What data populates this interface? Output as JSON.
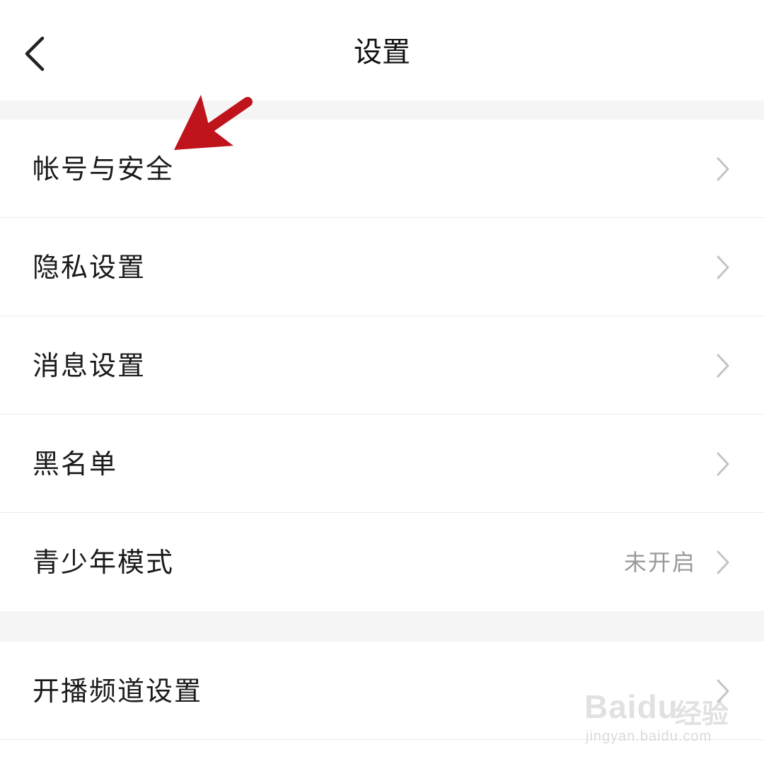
{
  "header": {
    "title": "设置",
    "back_icon": "chevron-left-icon"
  },
  "group1": {
    "items": [
      {
        "label": "帐号与安全",
        "icon": "chevron-right-icon"
      },
      {
        "label": "隐私设置",
        "icon": "chevron-right-icon"
      },
      {
        "label": "消息设置",
        "icon": "chevron-right-icon"
      },
      {
        "label": "黑名单",
        "icon": "chevron-right-icon"
      },
      {
        "label": "青少年模式",
        "value": "未开启",
        "icon": "chevron-right-icon"
      }
    ]
  },
  "group2": {
    "items": [
      {
        "label": "开播频道设置",
        "icon": "chevron-right-icon"
      }
    ]
  },
  "annotation": {
    "icon": "red-arrow-icon",
    "color": "#c0141c"
  },
  "watermark": {
    "logo": "Baidu",
    "text": "经验",
    "url": "jingyan.baidu.com"
  },
  "colors": {
    "background": "#ffffff",
    "section_gap": "#f5f5f5",
    "divider": "#ececec",
    "text_primary": "#1a1a1a",
    "text_secondary": "#9a9a9a",
    "chevron": "#c4c4c4"
  }
}
